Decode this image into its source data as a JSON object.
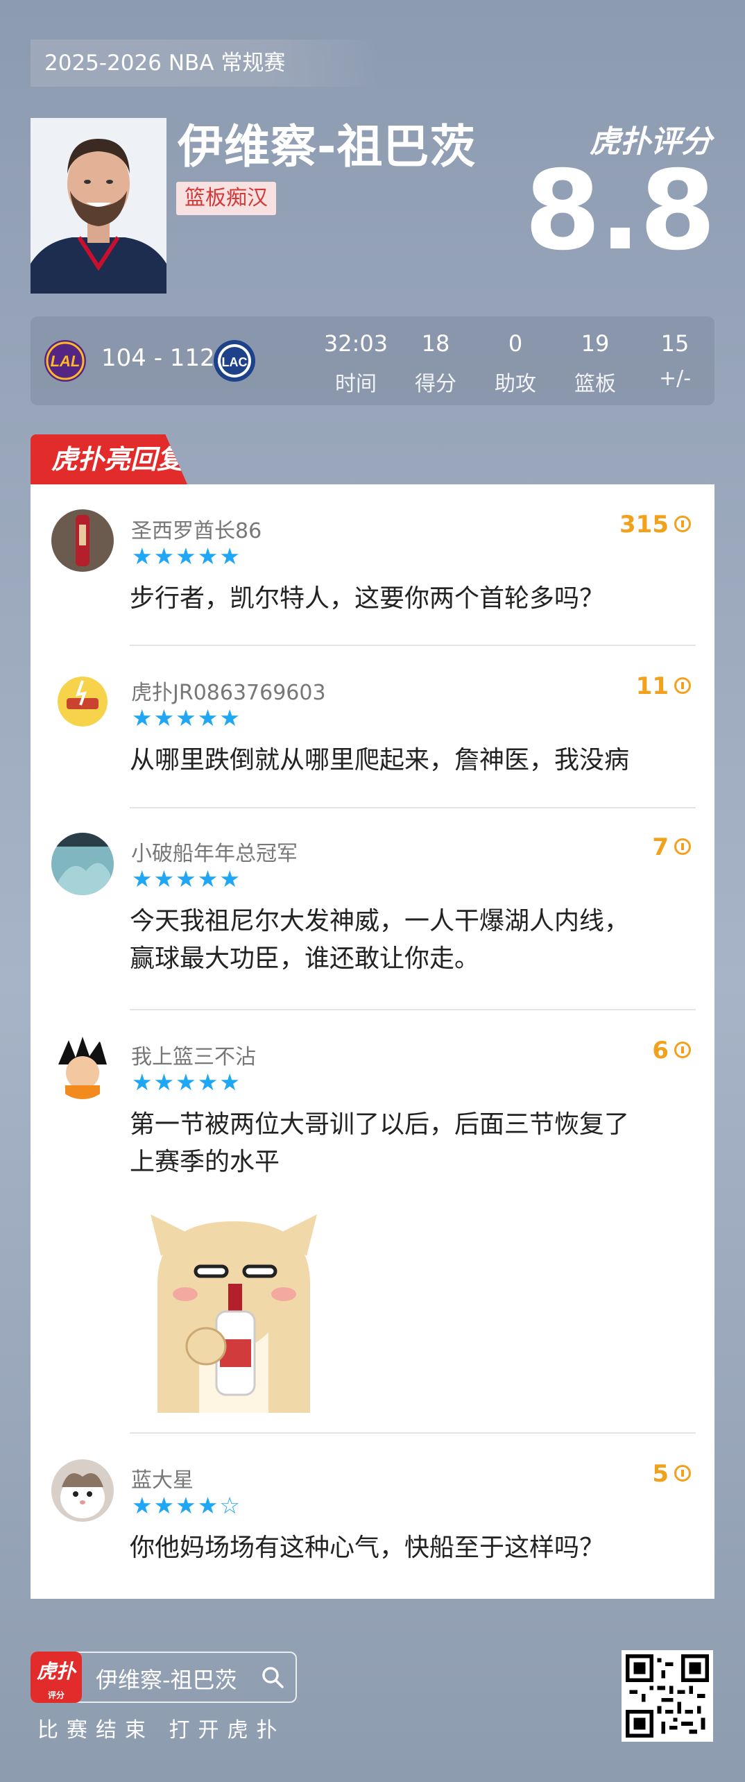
{
  "header": {
    "season": "2025-2026 NBA 常规赛",
    "player_name": "伊维察-祖巴茨",
    "tag": "篮板痴汉",
    "brand": "虎扑评分",
    "rating": "8.8"
  },
  "game": {
    "home_team": "LAL",
    "away_team": "LAC",
    "result": "104 - 112",
    "stats": [
      {
        "value": "32:03",
        "label": "时间"
      },
      {
        "value": "18",
        "label": "得分"
      },
      {
        "value": "0",
        "label": "助攻"
      },
      {
        "value": "19",
        "label": "篮板"
      },
      {
        "value": "15",
        "label": "+/-"
      }
    ]
  },
  "section_title": "虎扑亮回复",
  "comments": [
    {
      "user": "圣西罗酋长86",
      "stars": "★★★★★",
      "rating": 5,
      "likes": "315",
      "text": [
        "步行者，凯尔特人，这要你两个首轮多吗？"
      ]
    },
    {
      "user": "虎扑JR0863769603",
      "stars": "★★★★★",
      "rating": 5,
      "likes": "11",
      "text": [
        "从哪里跌倒就从哪里爬起来，詹神医，我没病"
      ]
    },
    {
      "user": "小破船年年总冠军",
      "stars": "★★★★★",
      "rating": 5,
      "likes": "7",
      "text": [
        "今天我祖尼尔大发神威，一人干爆湖人内线，",
        "赢球最大功臣，谁还敢让你走。"
      ]
    },
    {
      "user": "我上篮三不沾",
      "stars": "★★★★★",
      "rating": 5,
      "likes": "6",
      "text": [
        "第一节被两位大哥训了以后，后面三节恢复了",
        "上赛季的水平"
      ]
    },
    {
      "user": "蓝大星",
      "stars": "★★★★☆",
      "rating": 4,
      "likes": "5",
      "text": [
        "你他妈场场有这种心气，快船至于这样吗？"
      ]
    }
  ],
  "footer": {
    "logo_text": "虎扑",
    "logo_sub": "评分",
    "search_query": "伊维察-祖巴茨",
    "cta": "比赛结束 打开虎扑"
  },
  "colors": {
    "accent_red": "#e22b2b",
    "star_blue": "#1fa7f5",
    "likes_orange": "#f2a11d"
  }
}
